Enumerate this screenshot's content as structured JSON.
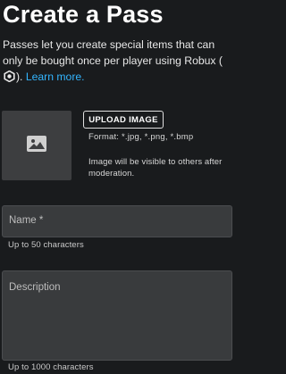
{
  "page": {
    "title": "Create a Pass",
    "description_part1": "Passes let you create special items that can only be bought once per player using Robux (",
    "description_part2": ").",
    "learn_more": "Learn more."
  },
  "image_upload": {
    "button_label": "UPLOAD IMAGE",
    "format_text": "Format: *.jpg, *.png, *.bmp",
    "moderation_text": "Image will be visible to others after moderation."
  },
  "name_field": {
    "placeholder": "Name *",
    "hint": "Up to 50 characters"
  },
  "description_field": {
    "placeholder": "Description",
    "hint": "Up to 1000 characters"
  },
  "icons": {
    "robux": "robux-icon",
    "image_placeholder": "image-icon"
  },
  "colors": {
    "background": "#191b1d",
    "link": "#33b5ff",
    "field_bg": "#393b3d"
  }
}
